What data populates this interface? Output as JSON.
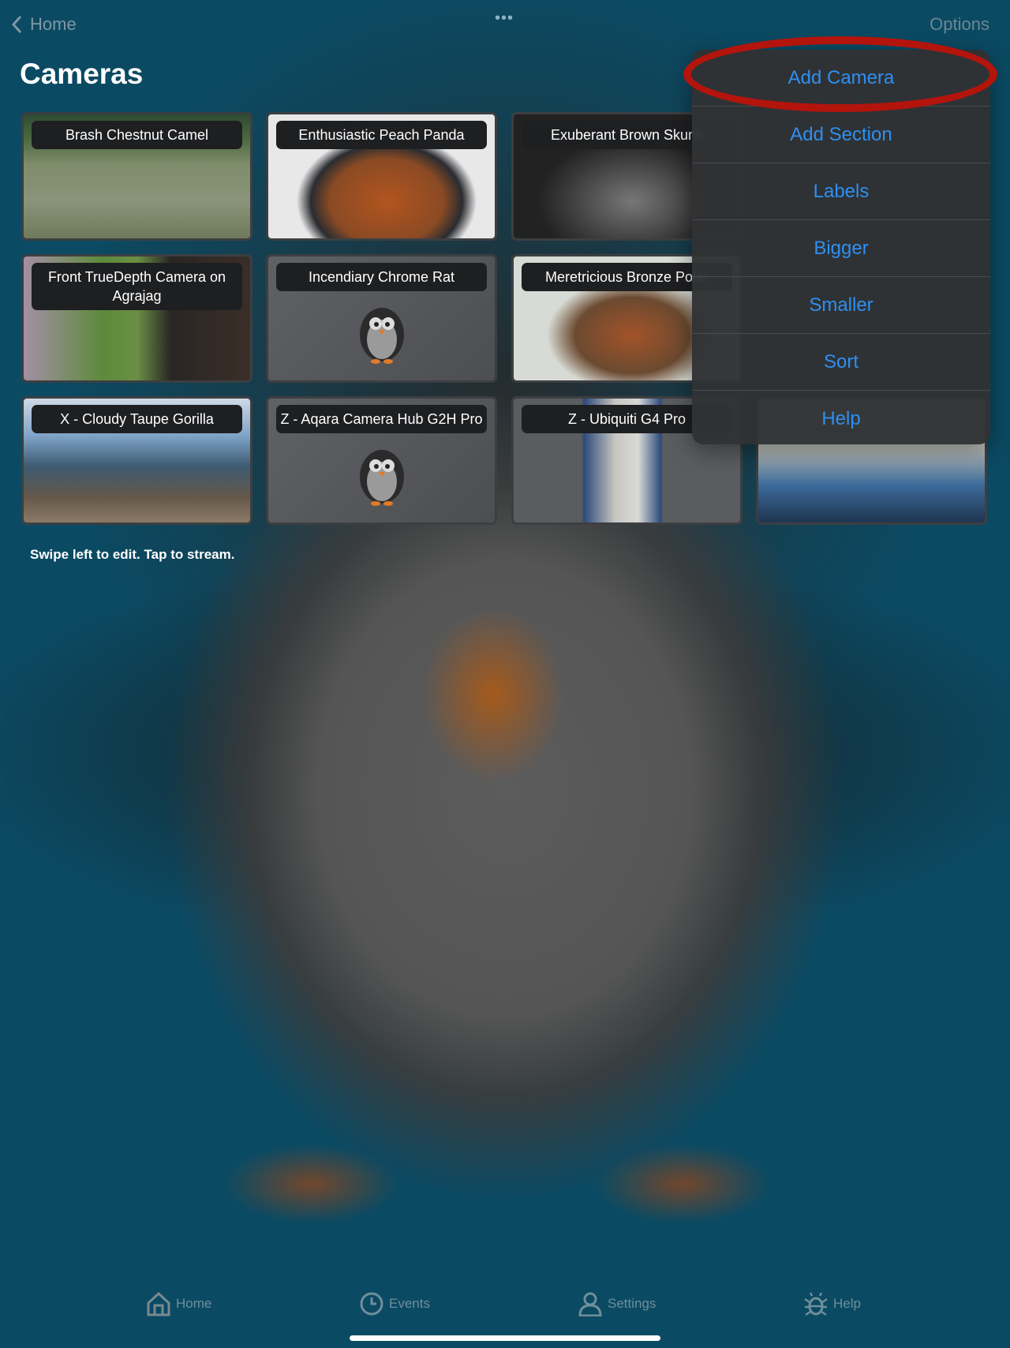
{
  "nav": {
    "back_label": "Home",
    "options_label": "Options",
    "more_icon": "ellipsis-icon"
  },
  "page_title": "Cameras",
  "cameras": [
    {
      "name": "Brash Chestnut Camel",
      "feed": "live"
    },
    {
      "name": "Enthusiastic Peach Panda",
      "feed": "live"
    },
    {
      "name": "Exuberant Brown Skunk",
      "feed": "live"
    },
    {
      "name": "",
      "feed": "hidden"
    },
    {
      "name": "Front TrueDepth Camera on Agrajag",
      "feed": "live"
    },
    {
      "name": "Incendiary Chrome Rat",
      "feed": "placeholder"
    },
    {
      "name": "Meretricious Bronze Polar",
      "feed": "live"
    },
    {
      "name": "",
      "feed": "hidden"
    },
    {
      "name": "X - Cloudy Taupe Gorilla",
      "feed": "live"
    },
    {
      "name": "Z - Aqara Camera Hub G2H Pro",
      "feed": "placeholder"
    },
    {
      "name": "Z - Ubiquiti G4 Pro",
      "feed": "live"
    },
    {
      "name": "",
      "feed": "live"
    }
  ],
  "hint": "Swipe left to edit. Tap to stream.",
  "menu": {
    "items": [
      "Add Camera",
      "Add Section",
      "Labels",
      "Bigger",
      "Smaller",
      "Sort",
      "Help"
    ],
    "highlighted": "Add Camera",
    "highlight_color": "#b3140c",
    "item_color": "#2f8ff0"
  },
  "tabs": [
    {
      "label": "Home",
      "icon": "home-icon"
    },
    {
      "label": "Events",
      "icon": "clock-icon"
    },
    {
      "label": "Settings",
      "icon": "person-icon"
    },
    {
      "label": "Help",
      "icon": "bug-icon"
    }
  ]
}
